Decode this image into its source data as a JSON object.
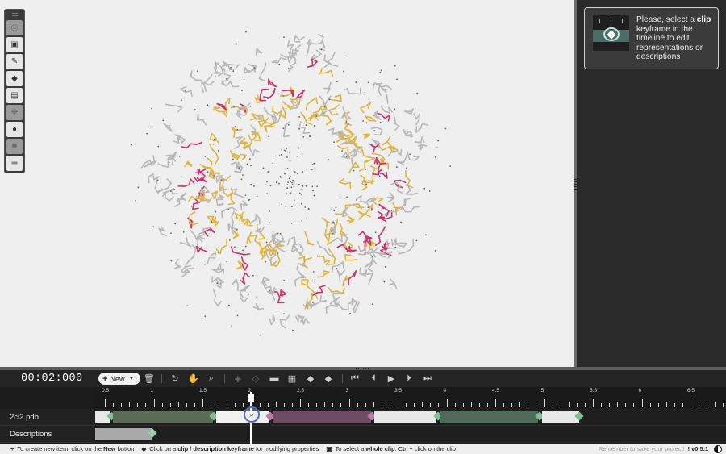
{
  "toolbar": {
    "icons": [
      "target-icon",
      "image-icon",
      "ruler-icon",
      "tag-icon",
      "archive-icon",
      "move-icon",
      "comment-icon",
      "settings-icon",
      "menu-icon"
    ]
  },
  "info_card": {
    "pre": "Please, select a ",
    "bold": "clip",
    "post": " keyframe in the timeline to edit representations or descriptions"
  },
  "timeline": {
    "time": "00:02:000",
    "new_label": "New",
    "ruler_labels": [
      "0.5",
      "1",
      "1.5",
      "2",
      "2.5",
      "3",
      "3.5",
      "4",
      "4.5",
      "5",
      "5.5",
      "6",
      "6.5"
    ],
    "tracks": [
      {
        "label": "2ci2.pdb"
      },
      {
        "label": "Descriptions"
      }
    ]
  },
  "status": {
    "tip1_pre": "To create new item, click on the ",
    "tip1_bold": "New",
    "tip1_post": " button",
    "tip2_pre": "Click on a ",
    "tip2_bold": "clip / description keyframe",
    "tip2_post": " for modifying properties",
    "tip3_pre": "To select a ",
    "tip3_bold": "whole clip",
    "tip3_post": ": Ctrl + click on the clip",
    "save_reminder": "Remember to save your project!",
    "version": "v0.5.1"
  },
  "colors": {
    "clip_green": "#5c6b56",
    "clip_purple": "#6e4d62",
    "clip_teal": "#4e6b5c",
    "clip_white": "#e8e8e8",
    "kf_green": "#7fbf92",
    "kf_pink": "#c07aa8",
    "molecule_gold": "#e3b43d",
    "molecule_pink": "#d0306b",
    "molecule_grey": "#b8b8b8"
  }
}
